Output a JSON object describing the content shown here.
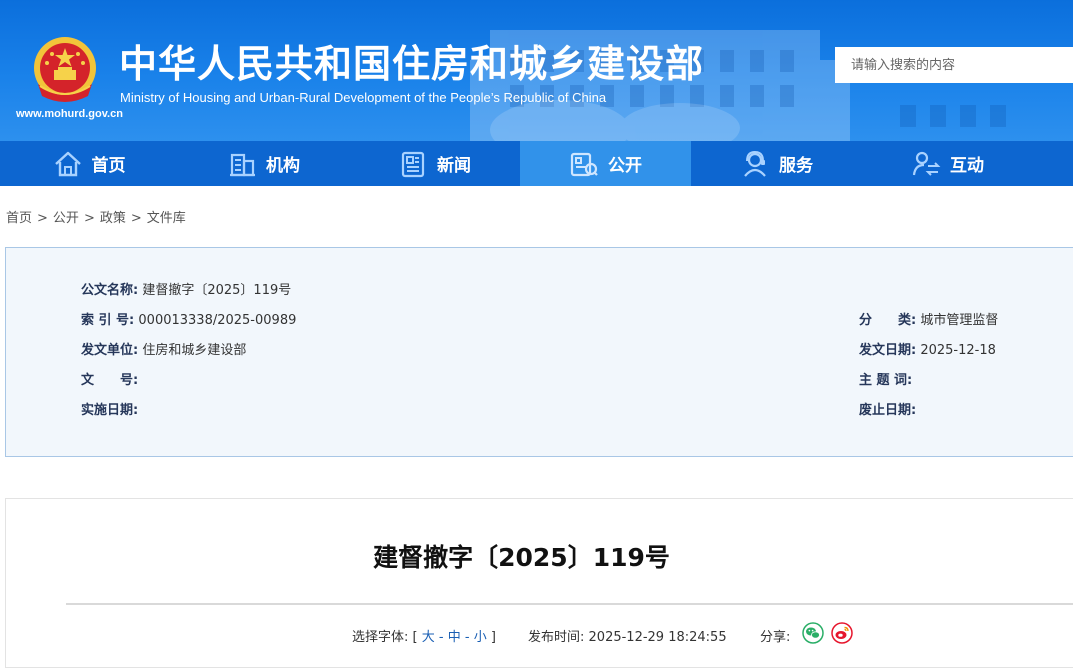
{
  "header": {
    "title": "中华人民共和国住房和城乡建设部",
    "subtitle": "Ministry of Housing and Urban-Rural Development of the People’s Republic of China",
    "url": "www.mohurd.gov.cn",
    "search_placeholder": "请输入搜索的内容"
  },
  "nav": {
    "items": [
      {
        "label": "首页",
        "icon": "home-icon"
      },
      {
        "label": "机构",
        "icon": "building-icon"
      },
      {
        "label": "新闻",
        "icon": "newspaper-icon"
      },
      {
        "label": "公开",
        "icon": "public-docs-icon",
        "active": true
      },
      {
        "label": "服务",
        "icon": "service-person-icon"
      },
      {
        "label": "互动",
        "icon": "interaction-icon"
      }
    ],
    "active_color": "#3192ea",
    "bar_color": "#0d66d0"
  },
  "breadcrumb": {
    "items": [
      "首页",
      "公开",
      "政策",
      "文件库"
    ],
    "separator": ">"
  },
  "info": {
    "doc_name_label": "公文名称:",
    "doc_name": "建督撤字〔2025〕119号",
    "index_label": "索 引 号:",
    "index_no": "000013338/2025-00989",
    "category_label": "分　　类:",
    "category": "城市管理监督",
    "issuer_label": "发文单位:",
    "issuer": "住房和城乡建设部",
    "issue_date_label": "发文日期:",
    "issue_date": "2025-12-18",
    "doc_no_label": "文　　号:",
    "doc_no": "",
    "subject_label": "主 题 词:",
    "subject": "",
    "effective_label": "实施日期:",
    "effective": "",
    "expiry_label": "废止日期:",
    "expiry": ""
  },
  "article": {
    "title": "建督撤字〔2025〕119号",
    "font_label": "选择字体:",
    "font_open": "[",
    "font_large": "大",
    "font_medium": "中",
    "font_small": "小",
    "font_dash": "-",
    "font_close": "]",
    "publish_label": "发布时间:",
    "publish_time": "2025-12-29 18:24:55",
    "share_label": "分享:",
    "share_icons": [
      "wechat-icon",
      "weibo-icon"
    ]
  }
}
